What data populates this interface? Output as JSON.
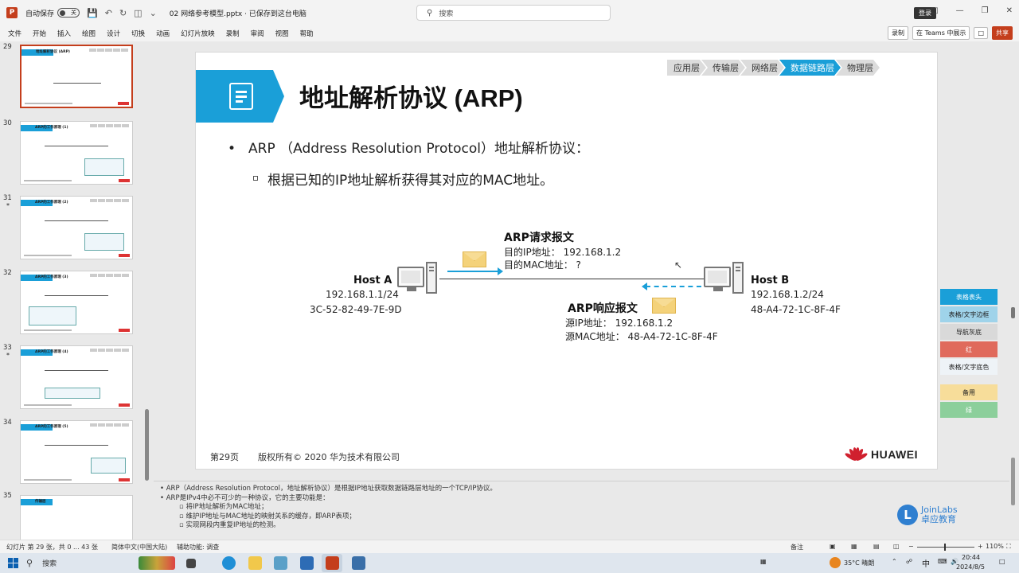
{
  "app": {
    "autosave_label": "自动保存",
    "autosave_state": "关",
    "doc_title": "02 网络参考模型.pptx  ·  已保存到这台电脑",
    "search_placeholder": "搜索",
    "signin_label": "登录"
  },
  "ribbon": {
    "tabs": [
      "文件",
      "开始",
      "插入",
      "绘图",
      "设计",
      "切换",
      "动画",
      "幻灯片放映",
      "录制",
      "审阅",
      "视图",
      "帮助"
    ],
    "record_label": "录制",
    "teams_label": "在 Teams 中展示",
    "share_label": "共享"
  },
  "thumbnails": [
    {
      "num": "29",
      "star": "",
      "title": "地址解析协议 (ARP)",
      "selected": true
    },
    {
      "num": "30",
      "star": "",
      "title": "ARP的工作原理 (1)",
      "selected": false
    },
    {
      "num": "31",
      "star": "*",
      "title": "ARP的工作原理 (2)",
      "selected": false
    },
    {
      "num": "32",
      "star": "",
      "title": "ARP的工作原理 (3)",
      "selected": false
    },
    {
      "num": "33",
      "star": "*",
      "title": "ARP的工作原理 (4)",
      "selected": false
    },
    {
      "num": "34",
      "star": "",
      "title": "ARP的工作原理 (5)",
      "selected": false
    },
    {
      "num": "35",
      "star": "",
      "title": "传输层",
      "selected": false
    }
  ],
  "slide": {
    "title": "地址解析协议 (ARP)",
    "layers": [
      "应用层",
      "传输层",
      "网络层",
      "数据链路层",
      "物理层"
    ],
    "active_layer": "数据链路层",
    "bullet1": "ARP （Address Resolution Protocol）地址解析协议：",
    "bullet2": "根据已知的IP地址解析获得其对应的MAC地址。",
    "host_a": {
      "name": "Host A",
      "ip": "192.168.1.1/24",
      "mac": "3C-52-82-49-7E-9D"
    },
    "host_b": {
      "name": "Host B",
      "ip": "192.168.1.2/24",
      "mac": "48-A4-72-1C-8F-4F"
    },
    "request": {
      "title": "ARP请求报文",
      "line1": "目的IP地址：  192.168.1.2",
      "line2": "目的MAC地址：  ?"
    },
    "reply": {
      "title": "ARP响应报文",
      "line1": "源IP地址：  192.168.1.2",
      "line2": "源MAC地址：  48-A4-72-1C-8F-4F"
    },
    "page": "第29页",
    "copyright": "版权所有© 2020 华为技术有限公司",
    "brand": "HUAWEI"
  },
  "color_panel": [
    {
      "label": "表格表头",
      "color": "#1a9fd8"
    },
    {
      "label": "表格/文字边框",
      "color": "#9fd3ea"
    },
    {
      "label": "导航灰底",
      "color": "#d9d9d9"
    },
    {
      "label": "红",
      "color": "#e06a5c"
    },
    {
      "label": "表格/文字底色",
      "color": "#eef3f7"
    },
    {
      "label": "备用",
      "color": "#f7dd9a"
    },
    {
      "label": "绿",
      "color": "#8ccf9b"
    }
  ],
  "notes": {
    "line1": "ARP（Address Resolution Protocol，地址解析协议）是根据IP地址获取数据链路层地址的一个TCP/IP协议。",
    "line2": "ARP是IPv4中必不可少的一种协议，它的主要功能是：",
    "line3": "将IP地址解析为MAC地址；",
    "line4": "维护IP地址与MAC地址的映射关系的缓存，即ARP表项；",
    "line5": "实现网段内重复IP地址的检测。"
  },
  "watermark": {
    "name": "JoinLabs",
    "sub": "卓应教育"
  },
  "status": {
    "slide_info": "幻灯片 第 29 张，共 0 ... 43 张",
    "language": "简体中文(中国大陆)",
    "accessibility": "辅助功能: 调查",
    "notes_label": "备注",
    "zoom": "110%"
  },
  "taskbar": {
    "search": "搜索",
    "weather": "35°C 晴朗",
    "ime": "中",
    "time": "20:44",
    "date": "2024/8/5"
  }
}
